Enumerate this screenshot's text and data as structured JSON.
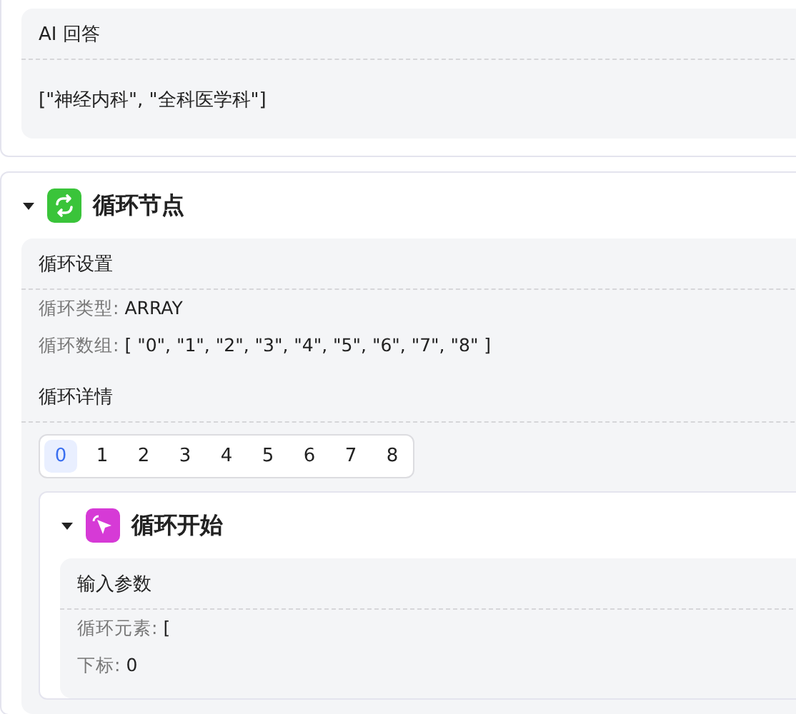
{
  "answer_section": {
    "title": "AI 回答",
    "content": "[\"神经内科\", \"全科医学科\"]"
  },
  "loop_node": {
    "title": "循环节点",
    "expanded": true,
    "settings": {
      "title": "循环设置",
      "fields": [
        {
          "label": "循环类型:",
          "value": "ARRAY"
        },
        {
          "label": "循环数组:",
          "value": "[ \"0\", \"1\", \"2\", \"3\", \"4\", \"5\", \"6\", \"7\", \"8\" ]"
        }
      ]
    },
    "details": {
      "title": "循环详情",
      "tabs": [
        {
          "label": "0",
          "selected": true
        },
        {
          "label": "1",
          "selected": false
        },
        {
          "label": "2",
          "selected": false
        },
        {
          "label": "3",
          "selected": false
        },
        {
          "label": "4",
          "selected": false
        },
        {
          "label": "5",
          "selected": false
        },
        {
          "label": "6",
          "selected": false
        },
        {
          "label": "7",
          "selected": false
        },
        {
          "label": "8",
          "selected": false
        }
      ],
      "child_node": {
        "title": "循环开始",
        "expanded": true,
        "params": {
          "title": "输入参数",
          "fields": [
            {
              "label": "循环元素:",
              "value": "["
            },
            {
              "label": "下标:",
              "value": "0"
            }
          ]
        }
      }
    }
  }
}
